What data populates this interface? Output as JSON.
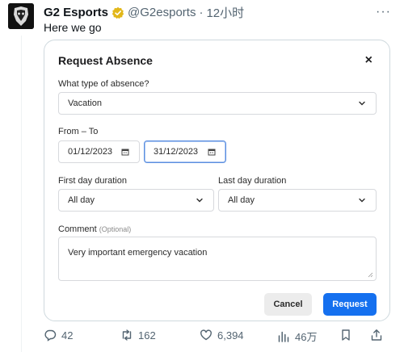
{
  "tweet": {
    "name": "G2 Esports",
    "handle": "@G2esports",
    "dot": "·",
    "time": "12小时",
    "more": "···",
    "text": "Here we go"
  },
  "modal": {
    "title": "Request Absence",
    "close": "×",
    "absence_type_label": "What type of absence?",
    "absence_type_value": "Vacation",
    "range_label": "From – To",
    "from_value": "01/12/2023",
    "to_value": "31/12/2023",
    "first_day_label": "First day duration",
    "first_day_value": "All day",
    "last_day_label": "Last day duration",
    "last_day_value": "All day",
    "comment_label": "Comment",
    "comment_optional": "(Optional)",
    "comment_value": "Very important emergency vacation",
    "cancel_label": "Cancel",
    "request_label": "Request"
  },
  "actions": {
    "replies": "42",
    "retweets": "162",
    "likes": "6,394",
    "views": "46万"
  },
  "colors": {
    "accent": "#1570ef",
    "verified": "#e2b719",
    "muted_text": "#536471"
  },
  "icons": [
    "avatar-logo",
    "verified-badge-icon",
    "more-icon",
    "close-icon",
    "chevron-down-icon",
    "calendar-icon",
    "resize-handle-icon",
    "reply-icon",
    "retweet-icon",
    "like-icon",
    "views-icon"
  ]
}
